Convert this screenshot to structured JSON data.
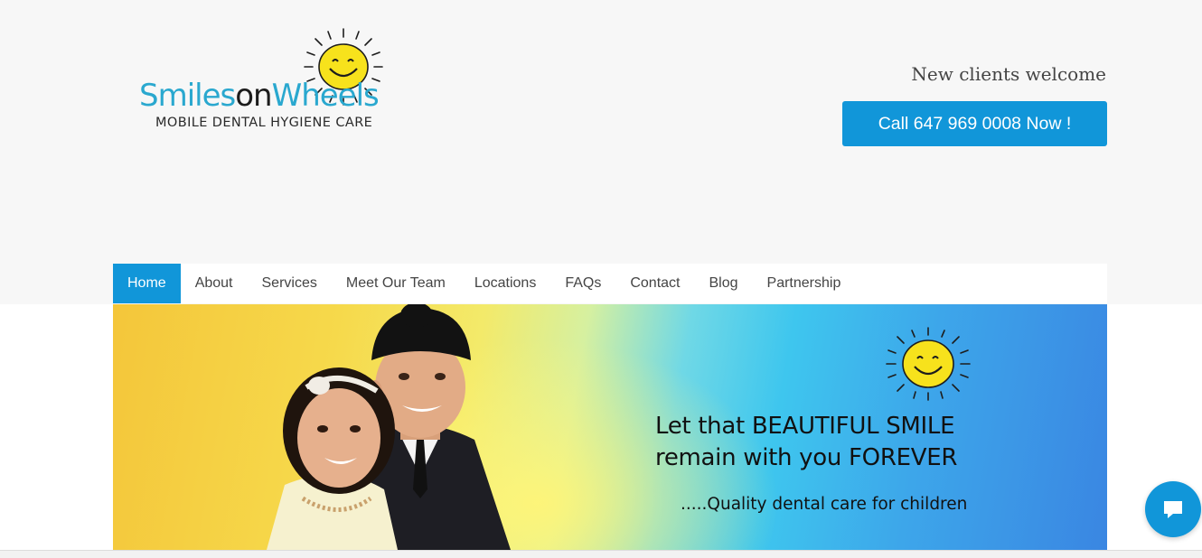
{
  "logo": {
    "title_part1": "Smiles",
    "title_part2": "on",
    "title_part3": "Wheels",
    "subtitle": "MOBILE DENTAL HYGIENE CARE"
  },
  "header": {
    "welcome": "New clients welcome",
    "call_label": "Call 647 969 0008 Now !"
  },
  "nav": {
    "items": [
      {
        "label": "Home",
        "active": true
      },
      {
        "label": "About"
      },
      {
        "label": "Services"
      },
      {
        "label": "Meet Our Team"
      },
      {
        "label": "Locations"
      },
      {
        "label": "FAQs"
      },
      {
        "label": "Contact"
      },
      {
        "label": "Blog"
      },
      {
        "label": "Partnership"
      }
    ]
  },
  "hero": {
    "line1": "Let that BEAUTIFUL SMILE",
    "line2": "remain with you FOREVER",
    "sub": ".....Quality dental care for children"
  },
  "colors": {
    "accent": "#1196d9",
    "logo_blue": "#2aa8cf",
    "sun_yellow": "#f7e21c"
  },
  "icons": {
    "chat": "chat-bubble-icon",
    "sun": "smiling-sun-icon"
  }
}
